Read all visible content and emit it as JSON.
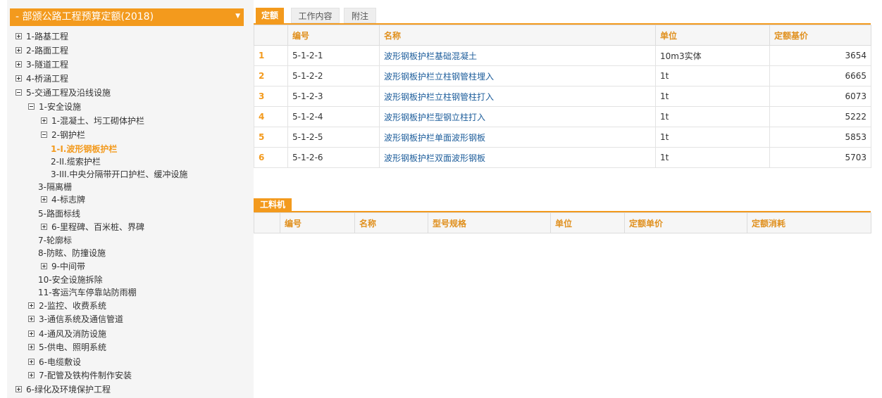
{
  "tree": {
    "header": "- 部颁公路工程预算定额(2018)",
    "items": [
      {
        "label": "1-路基工程",
        "toggle": "plus"
      },
      {
        "label": "2-路面工程",
        "toggle": "plus"
      },
      {
        "label": "3-隧道工程",
        "toggle": "plus"
      },
      {
        "label": "4-桥涵工程",
        "toggle": "plus"
      },
      {
        "label": "5-交通工程及沿线设施",
        "toggle": "minus"
      },
      {
        "label": "1-安全设施",
        "toggle": "minus"
      },
      {
        "label": "1-混凝土、圬工砌体护栏",
        "toggle": "plus"
      },
      {
        "label": "2-钢护栏",
        "toggle": "minus"
      },
      {
        "label": "1-I.波形钢板护栏",
        "toggle": "none",
        "active": true
      },
      {
        "label": "2-II.缆索护栏",
        "toggle": "none"
      },
      {
        "label": "3-III.中央分隔带开口护栏、缓冲设施",
        "toggle": "none"
      },
      {
        "label": "3-隔离栅",
        "toggle": "none"
      },
      {
        "label": "4-标志牌",
        "toggle": "plus"
      },
      {
        "label": "5-路面标线",
        "toggle": "none"
      },
      {
        "label": "6-里程碑、百米桩、界碑",
        "toggle": "plus"
      },
      {
        "label": "7-轮廓标",
        "toggle": "none"
      },
      {
        "label": "8-防眩、防撞设施",
        "toggle": "none"
      },
      {
        "label": "9-中间带",
        "toggle": "plus"
      },
      {
        "label": "10-安全设施拆除",
        "toggle": "none"
      },
      {
        "label": "11-客运汽车停靠站防雨棚",
        "toggle": "none"
      },
      {
        "label": "2-监控、收费系统",
        "toggle": "plus"
      },
      {
        "label": "3-通信系统及通信管道",
        "toggle": "plus"
      },
      {
        "label": "4-通风及消防设施",
        "toggle": "plus"
      },
      {
        "label": "5-供电、照明系统",
        "toggle": "plus"
      },
      {
        "label": "6-电缆敷设",
        "toggle": "plus"
      },
      {
        "label": "7-配管及铁构件制作安装",
        "toggle": "plus"
      },
      {
        "label": "6-绿化及环境保护工程",
        "toggle": "plus"
      }
    ]
  },
  "tabs": [
    {
      "label": "定额",
      "active": true
    },
    {
      "label": "工作内容",
      "active": false
    },
    {
      "label": "附注",
      "active": false
    }
  ],
  "quota": {
    "headers": [
      "",
      "编号",
      "名称",
      "单位",
      "定额基价"
    ],
    "rows": [
      [
        "1",
        "5-1-2-1",
        "波形钢板护栏基础混凝土",
        "10m3实体",
        "3654"
      ],
      [
        "2",
        "5-1-2-2",
        "波形钢板护栏立柱钢管柱埋入",
        "1t",
        "6665"
      ],
      [
        "3",
        "5-1-2-3",
        "波形钢板护栏立柱钢管柱打入",
        "1t",
        "6073"
      ],
      [
        "4",
        "5-1-2-4",
        "波形钢板护栏型钢立柱打入",
        "1t",
        "5222"
      ],
      [
        "5",
        "5-1-2-5",
        "波形钢板护栏单面波形钢板",
        "1t",
        "5853"
      ],
      [
        "6",
        "5-1-2-6",
        "波形钢板护栏双面波形钢板",
        "1t",
        "5703"
      ]
    ]
  },
  "materials": {
    "title": "工料机",
    "headers": [
      "",
      "编号",
      "名称",
      "型号规格",
      "单位",
      "定额单价",
      "定额消耗"
    ]
  },
  "colors": {
    "accent": "#f39a1d",
    "link": "#1d5d9b"
  }
}
